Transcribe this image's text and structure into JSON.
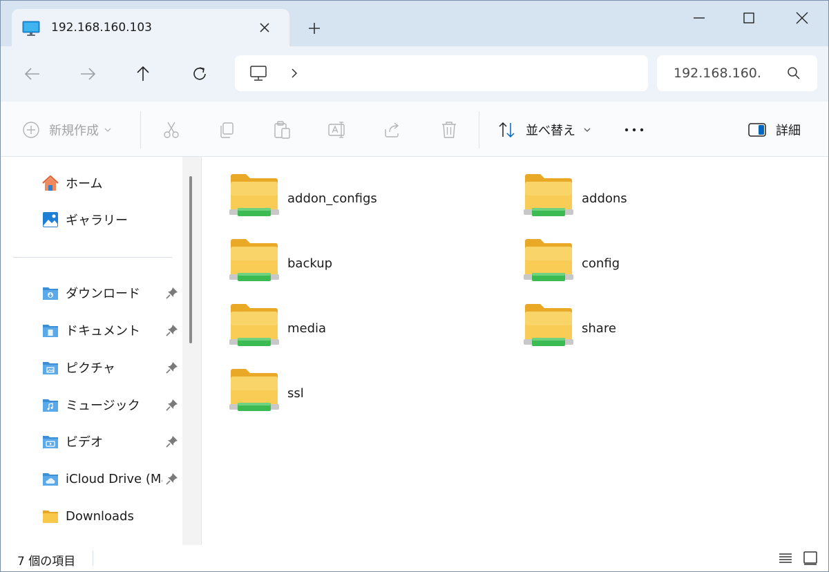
{
  "window": {
    "tab_title": "192.168.160.103",
    "new_tab_symbol": "+"
  },
  "navbar": {
    "search_text": "192.168.160."
  },
  "commandbar": {
    "new_label": "新規作成",
    "sort_label": "並べ替え",
    "details_label": "詳細"
  },
  "sidebar": {
    "top_items": [
      {
        "label": "ホーム",
        "icon": "home-icon"
      },
      {
        "label": "ギャラリー",
        "icon": "gallery-icon"
      }
    ],
    "pinned_items": [
      {
        "label": "ダウンロード",
        "icon": "downloads-folder-icon",
        "pinned": true
      },
      {
        "label": "ドキュメント",
        "icon": "documents-folder-icon",
        "pinned": true
      },
      {
        "label": "ピクチャ",
        "icon": "pictures-folder-icon",
        "pinned": true
      },
      {
        "label": "ミュージック",
        "icon": "music-folder-icon",
        "pinned": true
      },
      {
        "label": "ビデオ",
        "icon": "videos-folder-icon",
        "pinned": true
      },
      {
        "label": "iCloud Drive (Mac)",
        "icon": "icloud-folder-icon",
        "pinned": true
      },
      {
        "label": "Downloads",
        "icon": "folder-icon",
        "pinned": false
      }
    ]
  },
  "content": {
    "folders": [
      {
        "name": "addon_configs"
      },
      {
        "name": "addons"
      },
      {
        "name": "backup"
      },
      {
        "name": "config"
      },
      {
        "name": "media"
      },
      {
        "name": "share"
      },
      {
        "name": "ssl"
      }
    ]
  },
  "statusbar": {
    "item_count": "7 個の項目"
  },
  "colors": {
    "folder_yellow": "#f8c84a",
    "network_green": "#3cbb52",
    "accent_blue": "#0067c0"
  }
}
